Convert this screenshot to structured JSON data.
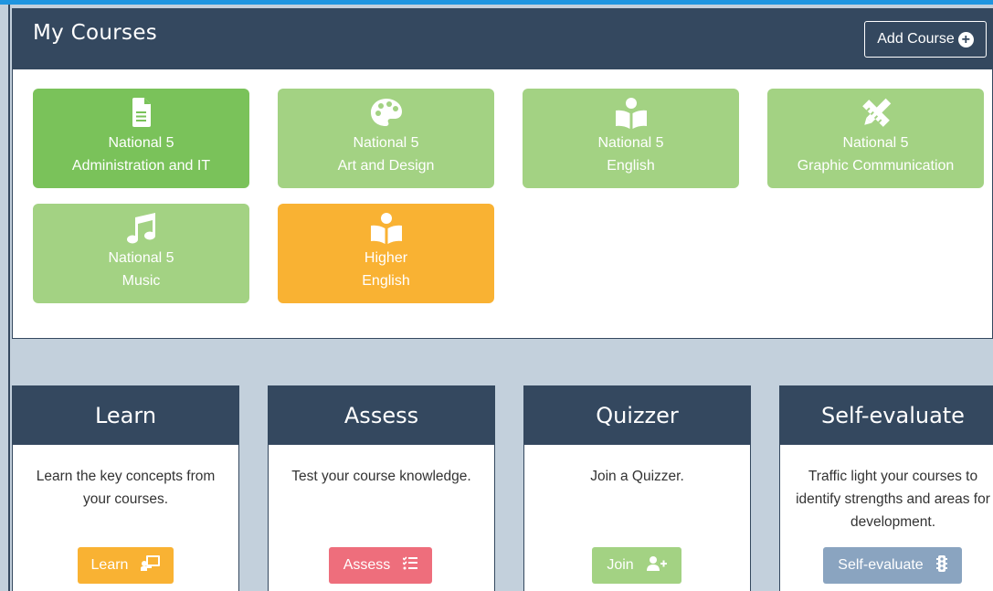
{
  "courses_panel": {
    "title": "My Courses",
    "add_button": "Add Course",
    "courses": [
      {
        "line1": "National 5",
        "line2": "Administration and IT",
        "icon": "document-icon",
        "color": "#7ac25a"
      },
      {
        "line1": "National 5",
        "line2": "Art and Design",
        "icon": "palette-icon",
        "color": "#a3d283"
      },
      {
        "line1": "National 5",
        "line2": "English",
        "icon": "reader-icon",
        "color": "#a3d283"
      },
      {
        "line1": "National 5",
        "line2": "Graphic Communication",
        "icon": "pencil-ruler-icon",
        "color": "#a3d283"
      },
      {
        "line1": "National 5",
        "line2": "Music",
        "icon": "music-note-icon",
        "color": "#a3d283"
      },
      {
        "line1": "Higher",
        "line2": "English",
        "icon": "reader-icon",
        "color": "#f9b233"
      }
    ]
  },
  "cards": [
    {
      "title": "Learn",
      "description": "Learn the key concepts from your courses.",
      "button": "Learn",
      "button_icon": "chalkboard-teacher-icon",
      "button_color": "#f9b233"
    },
    {
      "title": "Assess",
      "description": "Test your course knowledge.",
      "button": "Assess",
      "button_icon": "tasks-list-icon",
      "button_color": "#ee6e7c"
    },
    {
      "title": "Quizzer",
      "description": "Join a Quizzer.",
      "button": "Join",
      "button_icon": "user-plus-icon",
      "button_color": "#a3d283"
    },
    {
      "title": "Self-evaluate",
      "description": "Traffic light your courses to identify strengths and areas for development.",
      "button": "Self-evaluate",
      "button_icon": "traffic-light-icon",
      "button_color": "#8aa4c0"
    }
  ],
  "colors": {
    "header": "#34485f",
    "background": "#c3d0dc",
    "accent_top": "#1f95e0"
  }
}
